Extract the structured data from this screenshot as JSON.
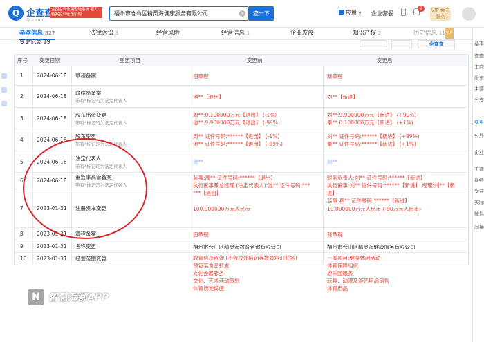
{
  "header": {
    "logo_text": "企查查",
    "logo_sub": "Qcc.com",
    "slogan": "全国企业信用查询系统 官方备案企业征信机构",
    "search_value": "福州市仓山区精灵海健康服务有限公司",
    "search_button": "查一下",
    "app_label": "应用",
    "enterprise_label": "企业套餐",
    "notif_count": "2",
    "vip_label": "VIP 会员服务"
  },
  "tabs": [
    {
      "label": "基本信息",
      "count": "827"
    },
    {
      "label": "法律诉讼",
      "count": "3"
    },
    {
      "label": "经营风险",
      "count": ""
    },
    {
      "label": "经营信息",
      "count": "1"
    },
    {
      "label": "企业发展",
      "count": ""
    },
    {
      "label": "知识产权",
      "count": "2"
    },
    {
      "label": "历史信息",
      "count": "11"
    }
  ],
  "subbar": {
    "title": "变更记录 19",
    "buttons": [
      "",
      "",
      "企查查"
    ]
  },
  "right_nav": [
    "基本",
    "查查",
    "工商",
    "股东",
    "主要",
    "分支",
    "变更",
    "对外",
    "企业",
    "工商",
    "最终",
    "受益",
    "实际",
    "疑似",
    "间接"
  ],
  "table": {
    "headers": [
      "序号",
      "变更日期",
      "变更项目",
      "变更前",
      "变更后"
    ],
    "rows": [
      {
        "no": "1",
        "date": "2024-06-18",
        "item": "章程备案",
        "item_sub": "",
        "before": [
          {
            "t": "旧章程",
            "c": "red"
          }
        ],
        "after": [
          {
            "t": "新章程",
            "c": "red"
          }
        ]
      },
      {
        "no": "2",
        "date": "2024-06-18",
        "item": "联络员备案",
        "item_sub": "带有*标记的为法定代表人",
        "before": [
          {
            "t": "池**【退出】",
            "c": "red"
          }
        ],
        "after": [
          {
            "t": "刘**【新进】",
            "c": "red"
          }
        ]
      },
      {
        "no": "3",
        "date": "2024-06-18",
        "item": "股东出资变更",
        "item_sub": "带有*标记的为法定代表人",
        "before": [
          {
            "t": "周**:0.100000万元【退出】 (-1%)",
            "c": "red"
          },
          {
            "t": "池**:9.900000万元【退出】 (-99%)",
            "c": "red"
          }
        ],
        "after": [
          {
            "t": "刘**:9.900000万元【新进】 (+99%)",
            "c": "red"
          },
          {
            "t": "秦**:0.100000万元【新进】 (+1%)",
            "c": "red"
          }
        ]
      },
      {
        "no": "4",
        "date": "2024-06-18",
        "item": "股东变更",
        "item_sub": "带有*标记的为法定代表人",
        "before": [
          {
            "t": "周** 证件号码:******【退出】 (-1%)",
            "c": "red"
          },
          {
            "t": "池** 证件号码:******【退出】 (-99%)",
            "c": "red"
          }
        ],
        "after": [
          {
            "t": "刘** 证件号码:******【新进】 (+99%)",
            "c": "red"
          },
          {
            "t": "秦** 证件号码:******【新进】 (+1%)",
            "c": "red"
          }
        ]
      },
      {
        "no": "5",
        "date": "2024-06-18",
        "item": "法定代表人",
        "item_sub": "带有*标记的为法定代表人",
        "before": [
          {
            "t": "池**",
            "c": "blur"
          }
        ],
        "after": [
          {
            "t": "刘**",
            "c": "blur"
          }
        ]
      },
      {
        "no": "6",
        "date": "2024-06-18",
        "item": "董监事高管备案",
        "item_sub": "带有*标记的为法定代表人",
        "before": [
          {
            "t": "监事:周** 证件号码:******【退出】",
            "c": "red"
          },
          {
            "t": "执行董事兼总经理 (法定代表人):池** 证件号码:***",
            "c": "red"
          },
          {
            "t": "***【退出】",
            "c": "red"
          }
        ],
        "after": [
          {
            "t": "财务负责人:刘** 证件号码:******【新进】",
            "c": "red"
          },
          {
            "t": "执行董事:刘** 证件号码:******【新进】 经理:刘**【新",
            "c": "red"
          },
          {
            "t": "进】",
            "c": "red"
          },
          {
            "t": "监事:秦** 证件号码:******【新进】",
            "c": "red"
          }
        ]
      },
      {
        "no": "7",
        "date": "2023-01-31",
        "item": "注册资本变更",
        "item_sub": "",
        "before": [
          {
            "t": "100.000000万元人民币",
            "c": "red"
          }
        ],
        "after": [
          {
            "t": "10.000000万元人民币 (-90万元人民币)",
            "c": "red"
          }
        ]
      },
      {
        "no": "8",
        "date": "2023-01-31",
        "item": "章程备案",
        "item_sub": "",
        "before": [
          {
            "t": "旧章程",
            "c": "red"
          }
        ],
        "after": [
          {
            "t": "新章程",
            "c": "red"
          }
        ]
      },
      {
        "no": "9",
        "date": "2023-01-31",
        "item": "名称变更",
        "item_sub": "",
        "before": [
          {
            "t": "福州市仓山区精灵海教育咨询有限公司",
            "c": "mixed"
          }
        ],
        "after": [
          {
            "t": "福州市仓山区精灵海健康服务有限公司",
            "c": "mixed"
          }
        ]
      },
      {
        "no": "10",
        "date": "2023-01-31",
        "item": "经营范围变更",
        "item_sub": "",
        "before": [
          {
            "t": "教育信息咨询 (不含校外培训等教育培训业务)",
            "c": "red"
          },
          {
            "t": "预包装食品批发",
            "c": "red"
          },
          {
            "t": "文化会展服务",
            "c": "red"
          },
          {
            "t": "文化、艺术活动策划",
            "c": "red"
          },
          {
            "t": "体育场地设施",
            "c": "red"
          }
        ],
        "after": [
          {
            "t": "一般项目:健身休闲活动",
            "c": "red"
          },
          {
            "t": "体育保障组织",
            "c": "red"
          },
          {
            "t": "游乐园服务",
            "c": "red"
          },
          {
            "t": "玩具、动漫及游艺用品销售",
            "c": "red"
          },
          {
            "t": "体育用品",
            "c": "red"
          }
        ]
      }
    ]
  },
  "watermark": {
    "icon": "N",
    "text": "智慧海都APP"
  },
  "colors": {
    "brand": "#1d6fd8",
    "accent_red": "#e8473b",
    "circle": "#d8232a"
  }
}
